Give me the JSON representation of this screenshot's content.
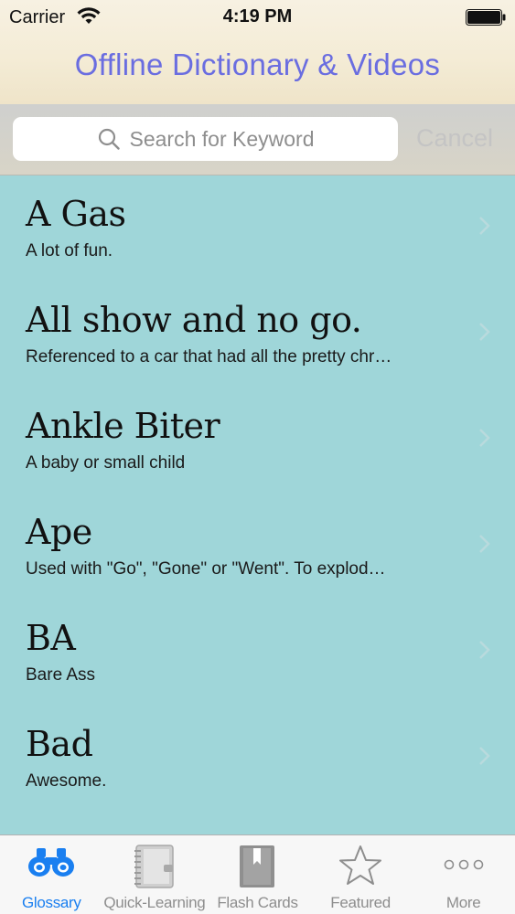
{
  "status_bar": {
    "carrier": "Carrier",
    "time": "4:19 PM"
  },
  "nav": {
    "title": "Offline Dictionary & Videos"
  },
  "search": {
    "placeholder": "Search for Keyword",
    "cancel_label": "Cancel"
  },
  "entries": [
    {
      "term": "A Gas",
      "definition": "A lot of fun."
    },
    {
      "term": "All show and no go.",
      "definition": "Referenced to a car that had all the pretty chr…"
    },
    {
      "term": "Ankle Biter",
      "definition": "A baby or small child"
    },
    {
      "term": "Ape",
      "definition": "Used with \"Go\", \"Gone\" or \"Went\". To explod…"
    },
    {
      "term": "BA",
      "definition": "Bare Ass"
    },
    {
      "term": "Bad",
      "definition": "Awesome."
    }
  ],
  "tabs": [
    {
      "label": "Glossary",
      "icon": "binoculars-icon",
      "active": true
    },
    {
      "label": "Quick-Learning",
      "icon": "notebook-icon",
      "active": false
    },
    {
      "label": "Flash Cards",
      "icon": "bookmark-book-icon",
      "active": false
    },
    {
      "label": "Featured",
      "icon": "star-icon",
      "active": false
    },
    {
      "label": "More",
      "icon": "more-dots-icon",
      "active": false
    }
  ],
  "colors": {
    "title": "#6a6de0",
    "list_background": "#9fd6d9",
    "active_tab": "#1a7ff0",
    "inactive_tab": "#8e8e8e"
  }
}
